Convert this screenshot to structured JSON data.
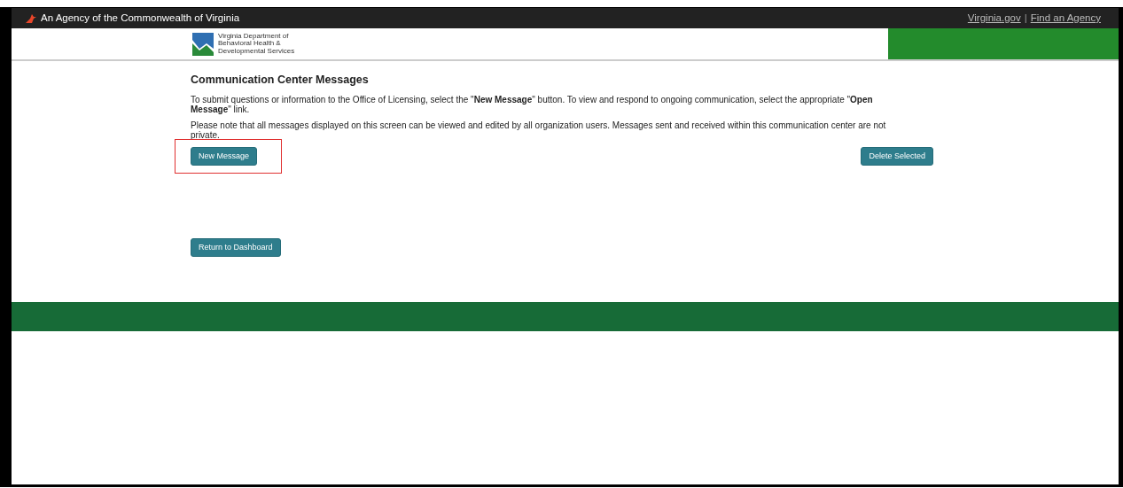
{
  "top_bar": {
    "agency_text": "An Agency of the Commonwealth of Virginia",
    "links": [
      "Virginia.gov",
      "Find an Agency"
    ],
    "separator": "|"
  },
  "header": {
    "logo_lines": [
      "Virginia Department of",
      "Behavioral Health &",
      "Developmental Services"
    ]
  },
  "main": {
    "title": "Communication Center Messages",
    "paragraphs": [
      "To submit questions or information to the Office of Licensing, select the \"**New Message**\" button. To view and respond to ongoing communication, select the appropriate \"**Open Message**\" link.",
      "Please note that all messages displayed on this screen can be viewed and edited by all organization users. Messages sent and received within this communication center are not private."
    ],
    "new_message_button": {
      "label": "New Message",
      "highlighted": true
    },
    "delete_button": {
      "label": "Delete Selected"
    },
    "return_button": {
      "label": "Return to Dashboard"
    }
  }
}
